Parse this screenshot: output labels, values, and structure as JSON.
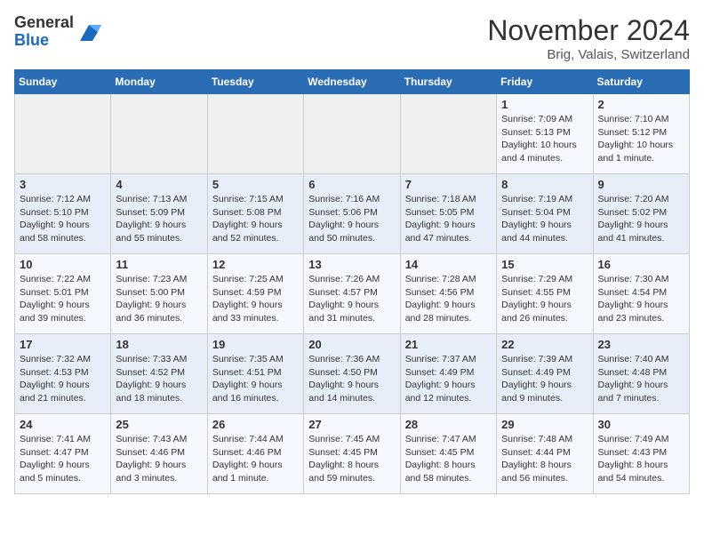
{
  "logo": {
    "general": "General",
    "blue": "Blue"
  },
  "title": "November 2024",
  "location": "Brig, Valais, Switzerland",
  "days_header": [
    "Sunday",
    "Monday",
    "Tuesday",
    "Wednesday",
    "Thursday",
    "Friday",
    "Saturday"
  ],
  "weeks": [
    [
      {
        "day": "",
        "info": ""
      },
      {
        "day": "",
        "info": ""
      },
      {
        "day": "",
        "info": ""
      },
      {
        "day": "",
        "info": ""
      },
      {
        "day": "",
        "info": ""
      },
      {
        "day": "1",
        "info": "Sunrise: 7:09 AM\nSunset: 5:13 PM\nDaylight: 10 hours\nand 4 minutes."
      },
      {
        "day": "2",
        "info": "Sunrise: 7:10 AM\nSunset: 5:12 PM\nDaylight: 10 hours\nand 1 minute."
      }
    ],
    [
      {
        "day": "3",
        "info": "Sunrise: 7:12 AM\nSunset: 5:10 PM\nDaylight: 9 hours\nand 58 minutes."
      },
      {
        "day": "4",
        "info": "Sunrise: 7:13 AM\nSunset: 5:09 PM\nDaylight: 9 hours\nand 55 minutes."
      },
      {
        "day": "5",
        "info": "Sunrise: 7:15 AM\nSunset: 5:08 PM\nDaylight: 9 hours\nand 52 minutes."
      },
      {
        "day": "6",
        "info": "Sunrise: 7:16 AM\nSunset: 5:06 PM\nDaylight: 9 hours\nand 50 minutes."
      },
      {
        "day": "7",
        "info": "Sunrise: 7:18 AM\nSunset: 5:05 PM\nDaylight: 9 hours\nand 47 minutes."
      },
      {
        "day": "8",
        "info": "Sunrise: 7:19 AM\nSunset: 5:04 PM\nDaylight: 9 hours\nand 44 minutes."
      },
      {
        "day": "9",
        "info": "Sunrise: 7:20 AM\nSunset: 5:02 PM\nDaylight: 9 hours\nand 41 minutes."
      }
    ],
    [
      {
        "day": "10",
        "info": "Sunrise: 7:22 AM\nSunset: 5:01 PM\nDaylight: 9 hours\nand 39 minutes."
      },
      {
        "day": "11",
        "info": "Sunrise: 7:23 AM\nSunset: 5:00 PM\nDaylight: 9 hours\nand 36 minutes."
      },
      {
        "day": "12",
        "info": "Sunrise: 7:25 AM\nSunset: 4:59 PM\nDaylight: 9 hours\nand 33 minutes."
      },
      {
        "day": "13",
        "info": "Sunrise: 7:26 AM\nSunset: 4:57 PM\nDaylight: 9 hours\nand 31 minutes."
      },
      {
        "day": "14",
        "info": "Sunrise: 7:28 AM\nSunset: 4:56 PM\nDaylight: 9 hours\nand 28 minutes."
      },
      {
        "day": "15",
        "info": "Sunrise: 7:29 AM\nSunset: 4:55 PM\nDaylight: 9 hours\nand 26 minutes."
      },
      {
        "day": "16",
        "info": "Sunrise: 7:30 AM\nSunset: 4:54 PM\nDaylight: 9 hours\nand 23 minutes."
      }
    ],
    [
      {
        "day": "17",
        "info": "Sunrise: 7:32 AM\nSunset: 4:53 PM\nDaylight: 9 hours\nand 21 minutes."
      },
      {
        "day": "18",
        "info": "Sunrise: 7:33 AM\nSunset: 4:52 PM\nDaylight: 9 hours\nand 18 minutes."
      },
      {
        "day": "19",
        "info": "Sunrise: 7:35 AM\nSunset: 4:51 PM\nDaylight: 9 hours\nand 16 minutes."
      },
      {
        "day": "20",
        "info": "Sunrise: 7:36 AM\nSunset: 4:50 PM\nDaylight: 9 hours\nand 14 minutes."
      },
      {
        "day": "21",
        "info": "Sunrise: 7:37 AM\nSunset: 4:49 PM\nDaylight: 9 hours\nand 12 minutes."
      },
      {
        "day": "22",
        "info": "Sunrise: 7:39 AM\nSunset: 4:49 PM\nDaylight: 9 hours\nand 9 minutes."
      },
      {
        "day": "23",
        "info": "Sunrise: 7:40 AM\nSunset: 4:48 PM\nDaylight: 9 hours\nand 7 minutes."
      }
    ],
    [
      {
        "day": "24",
        "info": "Sunrise: 7:41 AM\nSunset: 4:47 PM\nDaylight: 9 hours\nand 5 minutes."
      },
      {
        "day": "25",
        "info": "Sunrise: 7:43 AM\nSunset: 4:46 PM\nDaylight: 9 hours\nand 3 minutes."
      },
      {
        "day": "26",
        "info": "Sunrise: 7:44 AM\nSunset: 4:46 PM\nDaylight: 9 hours\nand 1 minute."
      },
      {
        "day": "27",
        "info": "Sunrise: 7:45 AM\nSunset: 4:45 PM\nDaylight: 8 hours\nand 59 minutes."
      },
      {
        "day": "28",
        "info": "Sunrise: 7:47 AM\nSunset: 4:45 PM\nDaylight: 8 hours\nand 58 minutes."
      },
      {
        "day": "29",
        "info": "Sunrise: 7:48 AM\nSunset: 4:44 PM\nDaylight: 8 hours\nand 56 minutes."
      },
      {
        "day": "30",
        "info": "Sunrise: 7:49 AM\nSunset: 4:43 PM\nDaylight: 8 hours\nand 54 minutes."
      }
    ]
  ]
}
